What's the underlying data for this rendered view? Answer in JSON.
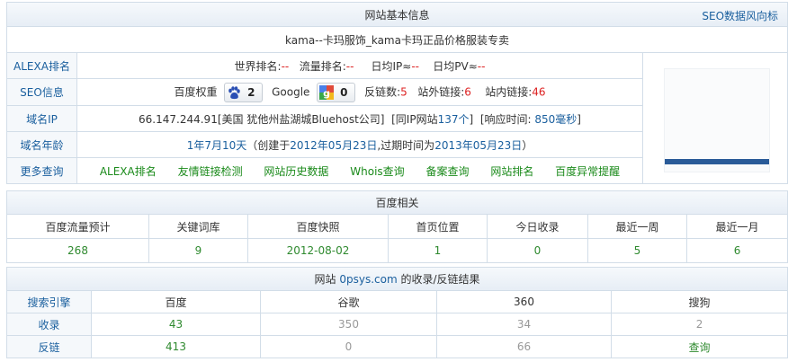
{
  "info": {
    "title": "网站基本信息",
    "seo_link": "SEO数据风向标",
    "site_title": "kama--卡玛服饰_kama卡玛正品价格服装专卖",
    "alexa": {
      "label": "ALEXA排名",
      "world_label": "世界排名:",
      "world_value": "--",
      "traffic_label": "流量排名:",
      "traffic_value": "--",
      "ip_label": "日均IP≈",
      "ip_value": "--",
      "pv_label": "日均PV≈",
      "pv_value": "--"
    },
    "seo": {
      "label": "SEO信息",
      "baidu_label": "百度权重",
      "baidu_value": "2",
      "google_label": "Google",
      "google_value": "0",
      "backlinks_label": "反链数:",
      "backlinks_value": "5",
      "outlinks_label": "站外链接:",
      "outlinks_value": "6",
      "inlinks_label": "站内链接:",
      "inlinks_value": "46"
    },
    "domain_ip": {
      "label": "域名IP",
      "ip_text": "66.147.244.91[美国 犹他州盐湖城Bluehost公司]",
      "same_ip_pre": "[同IP网站",
      "same_ip_value": "137个",
      "same_ip_post": "]",
      "resp_pre": "[响应时间:",
      "resp_value": "850毫秒",
      "resp_post": "]"
    },
    "age": {
      "label": "域名年龄",
      "value": "1年7月10天",
      "created_pre": "（创建于",
      "created": "2012年05月23日",
      "expires_pre": ",过期时间为",
      "expires": "2013年05月23日",
      "post": "）"
    },
    "more": {
      "label": "更多查询",
      "links": [
        "ALEXA排名",
        "友情链接检测",
        "网站历史数据",
        "Whois查询",
        "备案查询",
        "网站排名",
        "百度异常提醒"
      ]
    }
  },
  "baidu": {
    "title": "百度相关",
    "headers": [
      "百度流量预计",
      "关键词库",
      "百度快照",
      "首页位置",
      "今日收录",
      "最近一周",
      "最近一月"
    ],
    "values": [
      "268",
      "9",
      "2012-08-02",
      "1",
      "0",
      "5",
      "6"
    ]
  },
  "results": {
    "title_pre": "网站",
    "domain": "0psys.com",
    "title_post": "的收录/反链结果",
    "headers": [
      "搜索引擎",
      "百度",
      "谷歌",
      "360",
      "搜狗"
    ],
    "rows": [
      {
        "label": "收录",
        "values": [
          "43",
          "350",
          "34",
          "2"
        ]
      },
      {
        "label": "反链",
        "values": [
          "413",
          "0",
          "66",
          "查询"
        ]
      }
    ]
  },
  "colors": {
    "link_blue": "#1a5f9e",
    "value_red": "#d22222",
    "link_green": "#2f8a2f",
    "border": "#d2dde8"
  }
}
